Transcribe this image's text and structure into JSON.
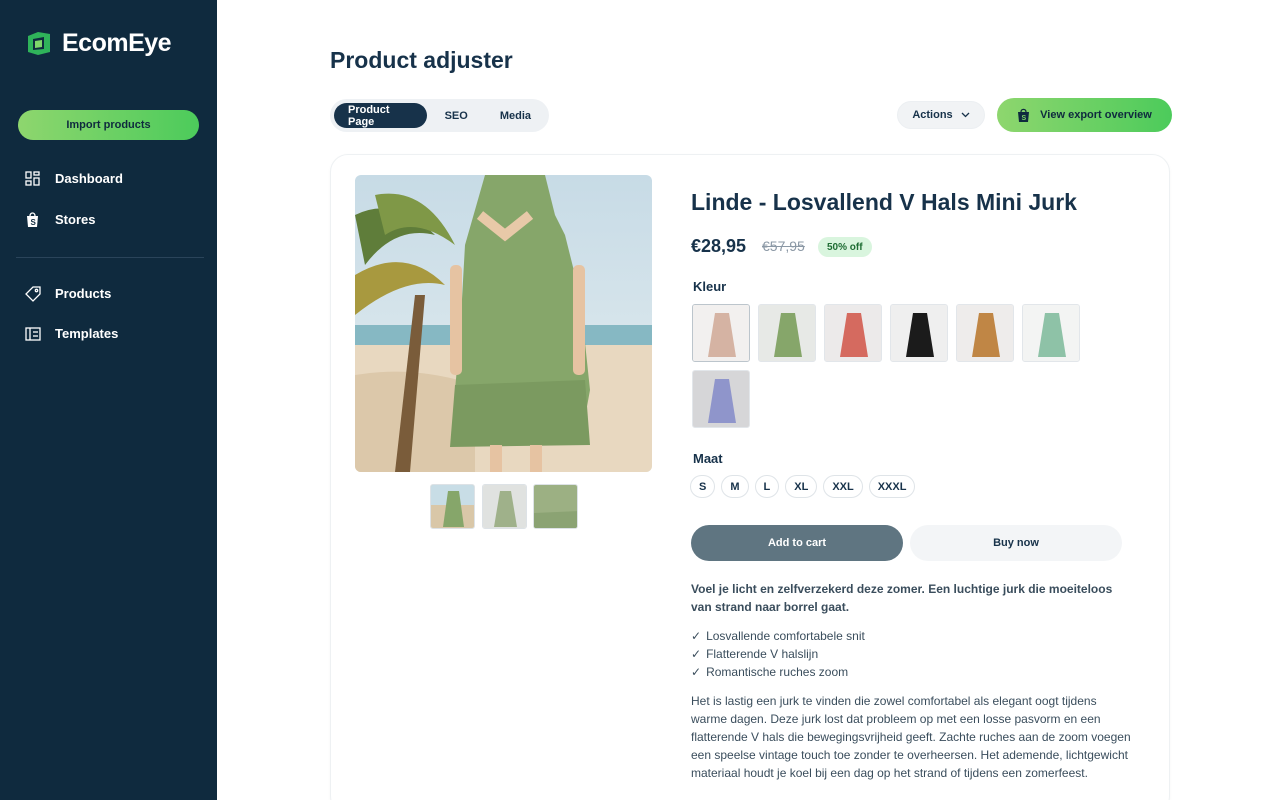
{
  "app": {
    "name": "EcomEye"
  },
  "sidebar": {
    "import_label": "Import products",
    "items": [
      {
        "label": "Dashboard",
        "icon": "grid-icon"
      },
      {
        "label": "Stores",
        "icon": "shopping-bag-icon"
      },
      {
        "label": "Products",
        "icon": "tag-icon"
      },
      {
        "label": "Templates",
        "icon": "template-icon"
      }
    ]
  },
  "header": {
    "title": "Product adjuster",
    "tabs": [
      {
        "label": "Product Page",
        "active": true
      },
      {
        "label": "SEO",
        "active": false
      },
      {
        "label": "Media",
        "active": false
      }
    ],
    "actions_label": "Actions",
    "export_label": "View export overview"
  },
  "product": {
    "title": "Linde - Losvallend V Hals Mini Jurk",
    "price": "€28,95",
    "old_price": "€57,95",
    "discount": "50% off",
    "color_label": "Kleur",
    "colors": [
      "beige",
      "green",
      "coral",
      "black",
      "caramel",
      "mint",
      "lavender"
    ],
    "size_label": "Maat",
    "sizes": [
      "S",
      "M",
      "L",
      "XL",
      "XXL",
      "XXXL"
    ],
    "add_to_cart": "Add to cart",
    "buy_now": "Buy now",
    "lead": "Voel je licht en zelfverzekerd deze zomer. Een luchtige jurk die moeiteloos van strand naar borrel gaat.",
    "bullets": [
      "Losvallende comfortabele snit",
      "Flatterende V halslijn",
      "Romantische ruches zoom"
    ],
    "check_mark": "✓",
    "description": "Het is lastig een jurk te vinden die zowel comfortabel als elegant oogt tijdens warme dagen. Deze jurk lost dat probleem op met een losse pasvorm en een flatterende V hals die bewegingsvrijheid geeft. Zachte ruches aan de zoom voegen een speelse vintage touch toe zonder te overheersen. Het ademende, lichtgewicht materiaal houdt je koel bij een dag op het strand of tijdens een zomerfeest."
  },
  "colors": {
    "sidebar_bg": "#0f2a3e",
    "accent_green": "#4ccb5b",
    "text_dark": "#17324a",
    "cart_button": "#5f7581"
  }
}
